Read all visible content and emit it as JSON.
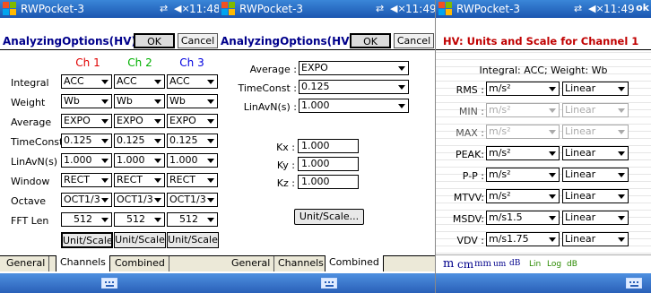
{
  "panel1": {
    "titlebar": {
      "app": "RWPocket-3",
      "time": "11:48"
    },
    "header": {
      "title": "AnalyzingOptions(HV):",
      "ok": "OK",
      "cancel": "Cancel"
    },
    "channels": [
      "Ch 1",
      "Ch 2",
      "Ch 3"
    ],
    "channel_colors": [
      "#e00000",
      "#00b000",
      "#0000e0"
    ],
    "rows": [
      {
        "label": "Integral",
        "values": [
          "ACC",
          "ACC",
          "ACC"
        ]
      },
      {
        "label": "Weight",
        "values": [
          "Wb",
          "Wb",
          "Wb"
        ]
      },
      {
        "label": "Average",
        "values": [
          "EXPO",
          "EXPO",
          "EXPO"
        ]
      },
      {
        "label": "TimeConst",
        "values": [
          "0.125",
          "0.125",
          "0.125"
        ]
      },
      {
        "label": "LinAvN(s)",
        "values": [
          "1.000",
          "1.000",
          "1.000"
        ]
      },
      {
        "label": "Window",
        "values": [
          "RECT",
          "RECT",
          "RECT"
        ]
      },
      {
        "label": "Octave",
        "values": [
          "OCT1/3",
          "OCT1/3",
          "OCT1/3"
        ]
      },
      {
        "label": "FFT Len",
        "values": [
          "512",
          "512",
          "512"
        ]
      }
    ],
    "unit_scale": "Unit/Scale",
    "tabs": [
      "General",
      "Channels",
      "Combined"
    ],
    "active_tab": "Channels"
  },
  "panel2": {
    "titlebar": {
      "app": "RWPocket-3",
      "time": "11:49"
    },
    "header": {
      "title": "AnalyzingOptions(HV):",
      "ok": "OK",
      "cancel": "Cancel"
    },
    "average": {
      "label": "Average :",
      "value": "EXPO"
    },
    "timeconst": {
      "label": "TimeConst :",
      "value": "0.125"
    },
    "linavn": {
      "label": "LinAvN(s) :",
      "value": "1.000"
    },
    "kx": {
      "label": "Kx :",
      "value": "1.000"
    },
    "ky": {
      "label": "Ky :",
      "value": "1.000"
    },
    "kz": {
      "label": "Kz :",
      "value": "1.000"
    },
    "unit_scale": "Unit/Scale...",
    "tabs": [
      "General",
      "Channels",
      "Combined"
    ],
    "active_tab": "Combined"
  },
  "panel3": {
    "titlebar": {
      "app": "RWPocket-3",
      "time": "11:49",
      "ok": "ok"
    },
    "header": {
      "title": "HV: Units and Scale for Channel 1"
    },
    "info": "Integral: ACC;  Weight: Wb",
    "rows": [
      {
        "label": "RMS :",
        "unit": "m/s²",
        "scale": "Linear",
        "enabled": true
      },
      {
        "label": "MIN :",
        "unit": "m/s²",
        "scale": "Linear",
        "enabled": false
      },
      {
        "label": "MAX :",
        "unit": "m/s²",
        "scale": "Linear",
        "enabled": false
      },
      {
        "label": "PEAK:",
        "unit": "m/s²",
        "scale": "Linear",
        "enabled": true
      },
      {
        "label": "P-P :",
        "unit": "m/s²",
        "scale": "Linear",
        "enabled": true
      },
      {
        "label": "MTVV:",
        "unit": "m/s²",
        "scale": "Linear",
        "enabled": true
      },
      {
        "label": "MSDV:",
        "unit": "m/s1.5",
        "scale": "Linear",
        "enabled": true
      },
      {
        "label": "VDV :",
        "unit": "m/s1.75",
        "scale": "Linear",
        "enabled": true
      }
    ],
    "toolbar": [
      "m",
      "cm",
      "mm",
      "um",
      "dB",
      "Lin",
      "Log",
      "dB"
    ]
  }
}
